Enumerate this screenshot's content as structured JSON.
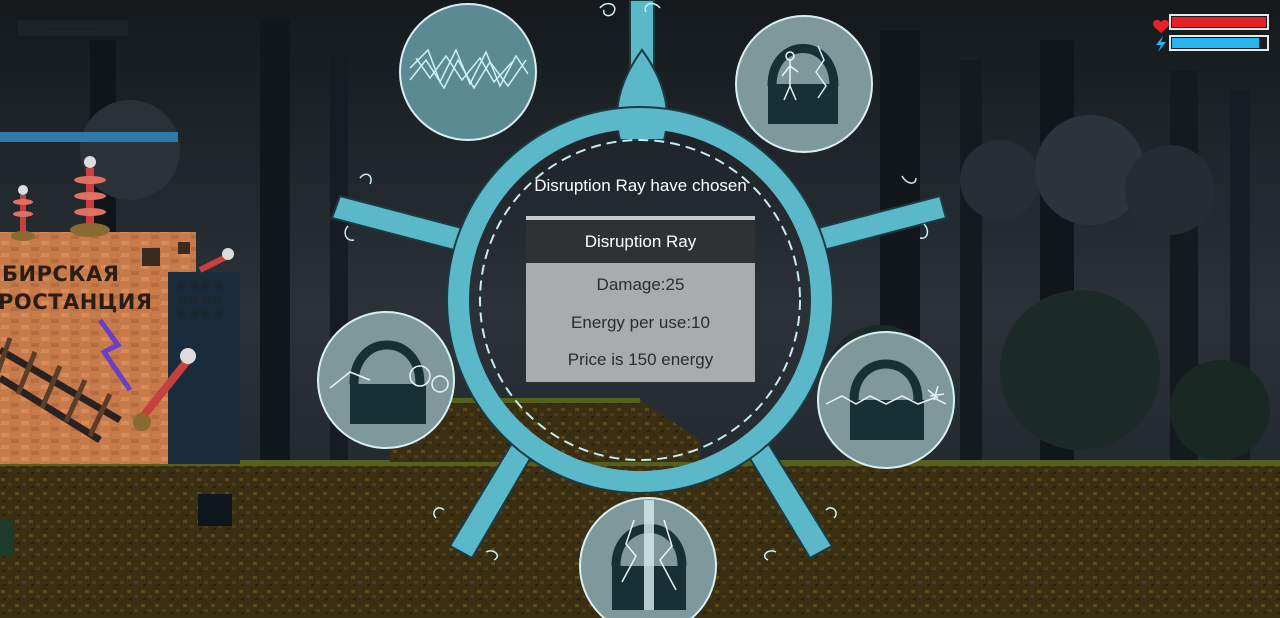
{
  "hud": {
    "health": 1.0,
    "energy": 0.93,
    "health_color": "#e8202a",
    "energy_color": "#24b4f0",
    "health_icon": "heart-icon",
    "energy_icon": "lightning-icon"
  },
  "station_sign": {
    "line1": "БИРСКАЯ",
    "line2": "РОСТАНЦИЯ"
  },
  "weapon_wheel": {
    "title": "Disruption Ray have chosen",
    "slots": [
      {
        "name": "chain-lightning-weapon-icon",
        "selected": false
      },
      {
        "name": "arc-shield-weapon-icon",
        "selected": false
      },
      {
        "name": "ground-wave-weapon-icon",
        "selected": false
      },
      {
        "name": "spark-burst-weapon-icon",
        "selected": false
      },
      {
        "name": "lightning-strike-weapon-icon",
        "selected": false
      }
    ],
    "accent_color": "#5ab8c8"
  },
  "weapon_info": {
    "name": "Disruption Ray",
    "damage": "Damage:25",
    "energy": "Energy per use:10",
    "price": "Price is 150 energy"
  }
}
